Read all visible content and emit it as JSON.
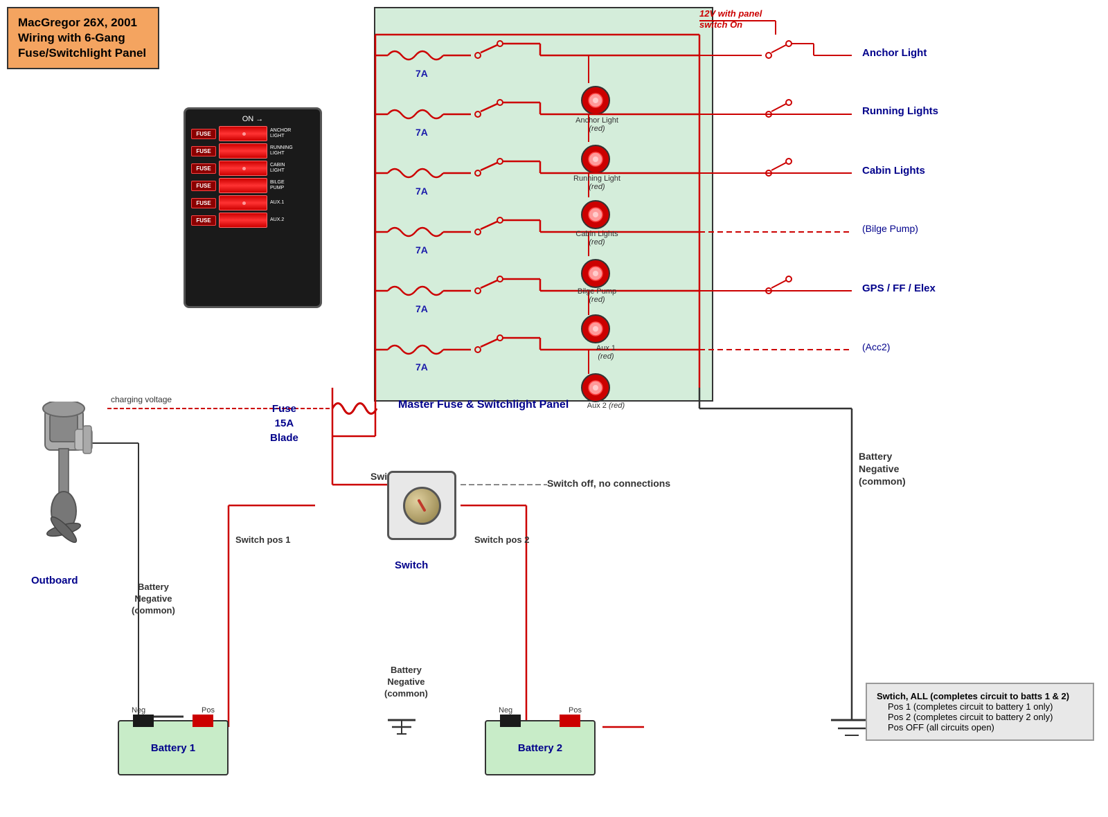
{
  "title": {
    "line1": "MacGregor 26X, 2001",
    "line2": "Wiring with 6-Gang",
    "line3": "Fuse/Switchlight Panel"
  },
  "panel": {
    "on_label": "ON →",
    "rows": [
      {
        "fuse": "FUSE",
        "label": "ANCHOR\nLIGHT",
        "has_dot": true
      },
      {
        "fuse": "FUSE",
        "label": "RUNNING\nLIGHT",
        "has_dot": false
      },
      {
        "fuse": "FUSE",
        "label": "CABIN\nLIGHT",
        "has_dot": true
      },
      {
        "fuse": "FUSE",
        "label": "BILGE\nPUMP",
        "has_dot": false
      },
      {
        "fuse": "FUSE",
        "label": "AUX.1",
        "has_dot": true
      },
      {
        "fuse": "FUSE",
        "label": "AUX.2",
        "has_dot": false
      }
    ]
  },
  "circuits": [
    {
      "name": "Anchor Light",
      "fuse": "7A",
      "color": "red"
    },
    {
      "name": "Running Lights",
      "fuse": "7A",
      "color": "red"
    },
    {
      "name": "Cabin Lights",
      "fuse": "7A",
      "color": "red"
    },
    {
      "name": "Bilge Pump",
      "fuse": "7A",
      "color": "dashed"
    },
    {
      "name": "GPS / FF / Elex",
      "fuse": "7A",
      "color": "red"
    },
    {
      "name": "Acc2",
      "fuse": "7A",
      "color": "dashed"
    }
  ],
  "labels": {
    "panel_title": "Master Fuse & Switchlight Panel",
    "v12_label": "12V with panel switch On",
    "charging_voltage": "charging voltage",
    "outboard": "Outboard",
    "fuse_main": "Fuse\n15A\nBlade",
    "switch_common": "Switch common",
    "switch_off": "Switch off, no connections",
    "switch_pos1": "Switch pos 1",
    "switch_pos2": "Switch pos 2",
    "battery1": "Battery 1",
    "battery2": "Battery 2",
    "battery_neg_common": "Battery\nNegative\n(common)",
    "battery_neg_common2": "Battery\nNegative\n(common)",
    "battery_neg_label1": "Battery\nNegative\n(common)",
    "switch_label": "Switch",
    "neg": "Neg",
    "pos": "Pos",
    "anchor_light": "Anchor Light",
    "running_lights": "Running Lights",
    "cabin_lights": "Cabin Lights",
    "bilge_pump": "(Bilge Pump)",
    "gps": "GPS / FF / Elex",
    "acc2": "(Acc2)",
    "lamp_anchor": "Anchor Light\n(red)",
    "lamp_running": "Running Light\n(red)",
    "lamp_cabin": "Cabin Lights\n(red)",
    "lamp_bilge": "Bilge Pump\n(red)",
    "lamp_aux1": "Aux 1\n(red)",
    "lamp_aux2": "Aux 2  (red)"
  },
  "legend": {
    "swtich_all": "Swtich, ALL (completes circuit to batts 1 & 2)",
    "pos1": "Pos 1 (completes circuit to battery 1 only)",
    "pos2": "Pos 2 (completes circuit to battery 2 only)",
    "pos_off": "Pos OFF (all circuits open)"
  },
  "colors": {
    "red": "#cc0000",
    "blue": "#00008b",
    "green_bg": "#d4edda",
    "orange_title": "#f4a460",
    "dark_blue": "#00008b"
  }
}
